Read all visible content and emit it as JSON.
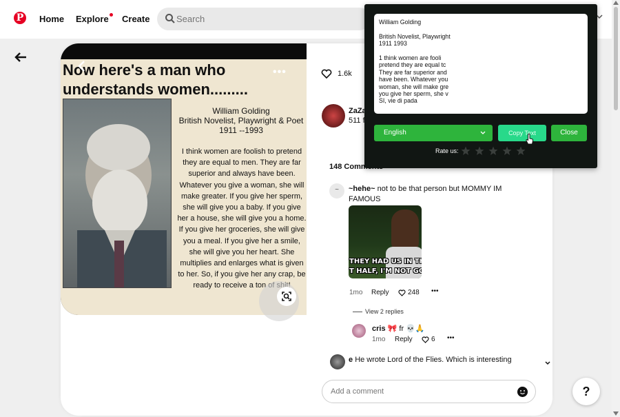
{
  "nav": {
    "logo": "P",
    "home": "Home",
    "explore": "Explore",
    "create": "Create",
    "search_placeholder": "Search"
  },
  "pin": {
    "headline": "Now here's a man who understands women.........",
    "bio": [
      "William Golding",
      "British Novelist, Playwright & Poet",
      "1911 --1993"
    ],
    "quote": "I think women are foolish to pretend they are equal to men. They are far superior and always have been. Whatever you give a woman, she will make greater. If you give her sperm, she will give you a baby. If you give her a house, she will give you a home. If you give her groceries, she will give you a meal. If you give her a smile, she will give you her heart. She multiplies and enlarges what is given to her. So, if you give her any crap, be ready to receive a ton of shit!",
    "likes": "1.6k",
    "menu": "•••"
  },
  "author": {
    "name": "ZaZa",
    "sub": "511 f"
  },
  "comments": {
    "count": "148 Comments",
    "c1": {
      "avatar": "~",
      "user": "~hehe~",
      "text": "not to be that person but MOMMY IM FAMOUS",
      "meme_top": "THEY HAD US IN THE",
      "meme_bottom": "T HALF, I'M NOT GON",
      "time": "1mo",
      "reply": "Reply",
      "likes": "248",
      "more": "•••"
    },
    "view_replies": "View 2 replies",
    "c2": {
      "user": "cris",
      "text": "🎀 fr 💀🙏",
      "time": "1mo",
      "reply": "Reply",
      "likes": "6",
      "more": "•••"
    },
    "c3": {
      "user": "e",
      "text": "He wrote Lord of the Flies. Which is interesting"
    },
    "add_placeholder": "Add a comment"
  },
  "help": "?",
  "extension": {
    "ocr_text": "William Golding\n\nBritish Novelist, Playwright\n1911 1993\n\n1 think women are fooli\npretend they are equal tc\nThey are far superior and\nhave been. Whatever you\nwoman, she will make gre\nyou give her sperm, she v\nSI, vie di pada",
    "language": "English",
    "copy": "Copy Text",
    "close": "Close",
    "rate": "Rate us:",
    "stars": 0
  },
  "colors": {
    "brand": "#e60023",
    "ext_green": "#2eb43c",
    "ext_copy": "#28d98a",
    "ext_bg": "#111613"
  }
}
